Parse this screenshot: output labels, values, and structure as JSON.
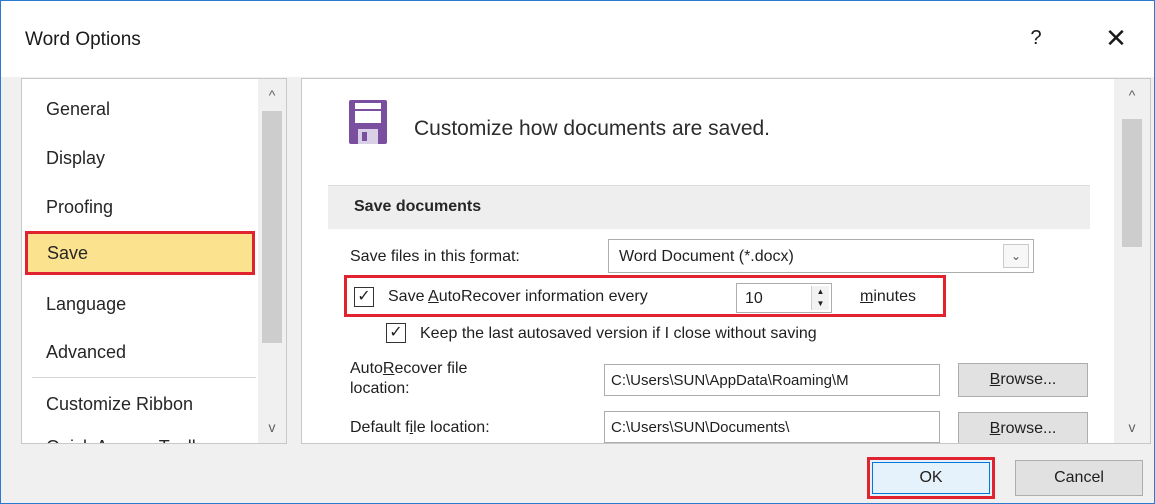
{
  "window": {
    "title": "Word Options",
    "help_label": "?",
    "close_label": "✕"
  },
  "nav": {
    "items": [
      {
        "label": "General"
      },
      {
        "label": "Display"
      },
      {
        "label": "Proofing"
      },
      {
        "label": "Save",
        "selected": true
      },
      {
        "label": "Language"
      },
      {
        "label": "Advanced"
      },
      {
        "label": "Customize Ribbon"
      },
      {
        "label": "Quick Access Toolbar"
      }
    ],
    "scroll_up": "^",
    "scroll_down": "v"
  },
  "main": {
    "header": "Customize how documents are saved.",
    "section_title": "Save documents",
    "format_label": {
      "pre": "Save files in this ",
      "u": "f",
      "post": "ormat:"
    },
    "format_value": "Word Document (*.docx)",
    "autorecover": {
      "checked": true,
      "label_pre": "Save ",
      "label_u": "A",
      "label_post": "utoRecover information every",
      "minutes_value": "10",
      "minutes_u": "m",
      "minutes_post": "inutes"
    },
    "keep_last": {
      "checked": true,
      "label": "Keep the last autosaved version if I close without saving"
    },
    "autorecover_location": {
      "label_pre": "Auto",
      "label_u": "R",
      "label_post": "ecover file",
      "label_line2": "location:",
      "value": "C:\\Users\\SUN\\AppData\\Roaming\\M"
    },
    "default_location": {
      "label_pre": "Default f",
      "label_u": "i",
      "label_post": "le location:",
      "value": "C:\\Users\\SUN\\Documents\\"
    },
    "browse_u": "B",
    "browse_post": "rowse...",
    "scroll_up": "^",
    "scroll_down": "v"
  },
  "footer": {
    "ok_label": "OK",
    "cancel_label": "Cancel"
  },
  "colors": {
    "highlight_border": "#e0232f",
    "selected_bg": "#fbe28e",
    "icon_purple": "#7a4fa0"
  },
  "icons": {
    "save": "floppy-disk-icon"
  }
}
